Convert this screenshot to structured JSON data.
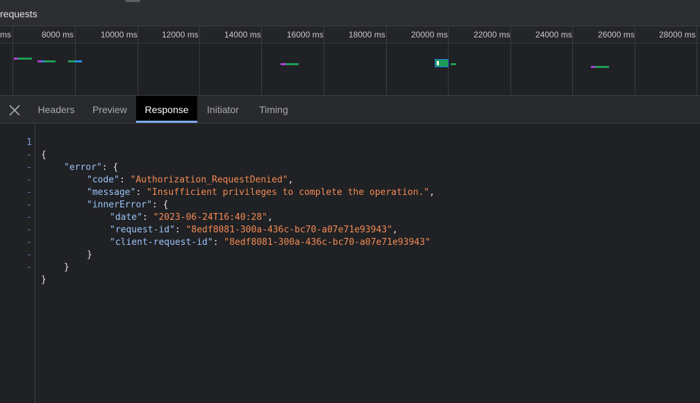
{
  "header": {
    "title": "requests"
  },
  "timeline": {
    "ticks": [
      {
        "label": "ms"
      },
      {
        "label": "8000 ms"
      },
      {
        "label": "10000 ms"
      },
      {
        "label": "12000 ms"
      },
      {
        "label": "14000 ms"
      },
      {
        "label": "16000 ms"
      },
      {
        "label": "18000 ms"
      },
      {
        "label": "20000 ms"
      },
      {
        "label": "22000 ms"
      },
      {
        "label": "24000 ms"
      },
      {
        "label": "26000 ms"
      },
      {
        "label": "28000 ms"
      }
    ],
    "colors": {
      "waiting": "#1e9c57",
      "queue": "#a845d6",
      "download": "#2a8ce0",
      "selected": "#1a73e8"
    }
  },
  "tabs": [
    {
      "label": "Headers"
    },
    {
      "label": "Preview"
    },
    {
      "label": "Response",
      "active": true
    },
    {
      "label": "Initiator"
    },
    {
      "label": "Timing"
    }
  ],
  "editor": {
    "lines": [
      {
        "num": "1",
        "text": "{"
      },
      {
        "num": "-",
        "key": "\"error\"",
        "rest": ": {"
      },
      {
        "num": "-",
        "key": "\"code\"",
        "sep": ": ",
        "val": "\"Authorization_RequestDenied\"",
        "end": ","
      },
      {
        "num": "-",
        "key": "\"message\"",
        "sep": ": ",
        "val": "\"Insufficient privileges to complete the operation.\"",
        "end": ","
      },
      {
        "num": "-",
        "key": "\"innerError\"",
        "rest": ": {"
      },
      {
        "num": "-",
        "key": "\"date\"",
        "sep": ": ",
        "val": "\"2023-06-24T16:40:28\"",
        "end": ","
      },
      {
        "num": "-",
        "key": "\"request-id\"",
        "sep": ": ",
        "val": "\"8edf8081-300a-436c-bc70-a07e71e93943\"",
        "end": ","
      },
      {
        "num": "-",
        "key": "\"client-request-id\"",
        "sep": ": ",
        "val": "\"8edf8081-300a-436c-bc70-a07e71e93943\"",
        "end": ""
      },
      {
        "num": "-",
        "text": "}"
      },
      {
        "num": "-",
        "text": "}"
      },
      {
        "num": "-",
        "text": "}"
      }
    ]
  }
}
